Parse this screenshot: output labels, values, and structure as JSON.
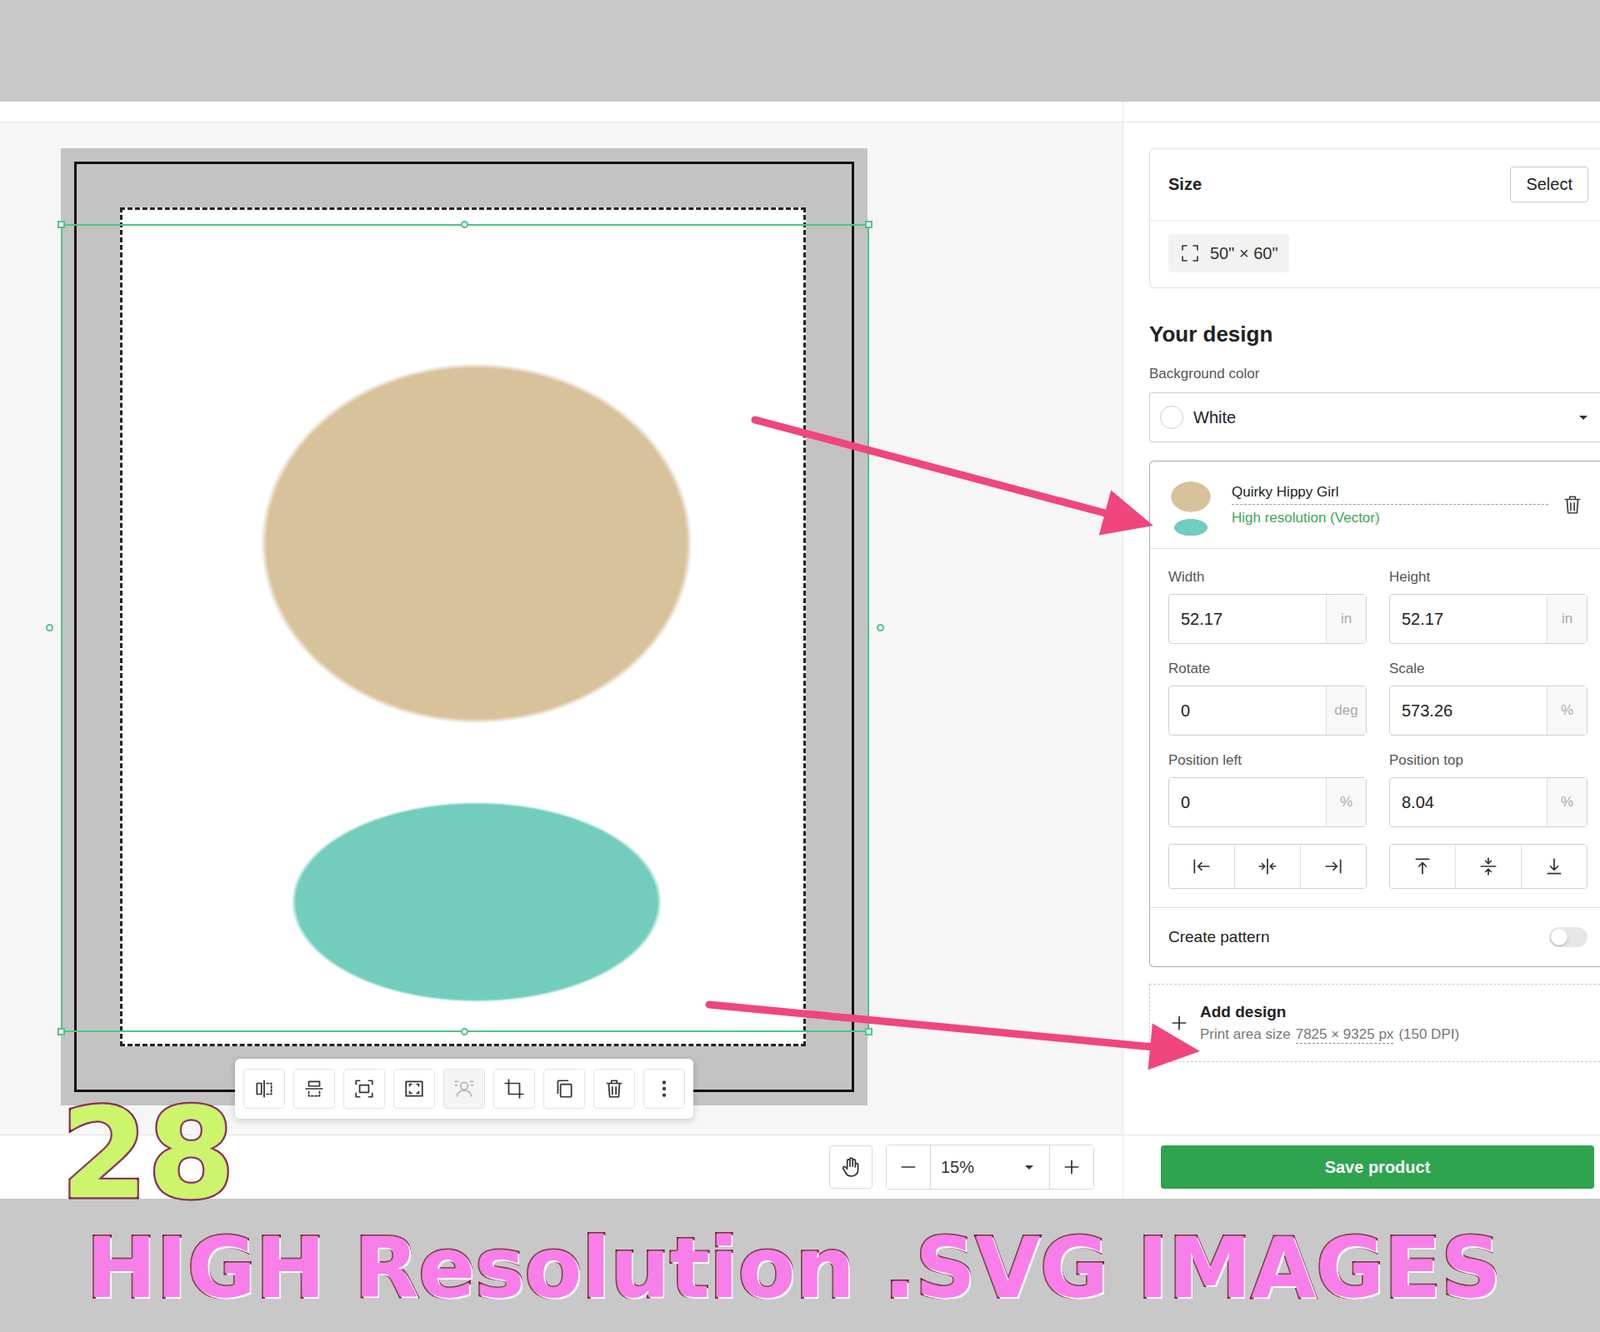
{
  "canvas": {
    "toolbar": [
      {
        "kind": "flip-h",
        "disabled": false
      },
      {
        "kind": "flip-v",
        "disabled": false
      },
      {
        "kind": "fit",
        "disabled": false
      },
      {
        "kind": "fill",
        "disabled": false
      },
      {
        "kind": "remove-bg",
        "disabled": true
      },
      {
        "kind": "crop",
        "disabled": false
      },
      {
        "kind": "copy",
        "disabled": false
      },
      {
        "kind": "trash",
        "disabled": false
      },
      {
        "kind": "more",
        "disabled": false
      }
    ]
  },
  "zoom": {
    "value": "15%"
  },
  "panel": {
    "size": {
      "label": "Size",
      "button": "Select",
      "value": "50\" × 60\""
    },
    "design_heading": "Your design",
    "background": {
      "label": "Background color",
      "value": "White"
    },
    "layer": {
      "name": "Quirky Hippy Girl",
      "quality": "High resolution (Vector)"
    },
    "fields": [
      {
        "label": "Width",
        "value": "52.17",
        "unit": "in"
      },
      {
        "label": "Height",
        "value": "52.17",
        "unit": "in"
      },
      {
        "label": "Rotate",
        "value": "0",
        "unit": "deg"
      },
      {
        "label": "Scale",
        "value": "573.26",
        "unit": "%"
      },
      {
        "label": "Position left",
        "value": "0",
        "unit": "%"
      },
      {
        "label": "Position top",
        "value": "8.04",
        "unit": "%"
      }
    ],
    "pattern": {
      "label": "Create pattern",
      "on": false
    },
    "add": {
      "label": "Add design",
      "prefix": "Print area size",
      "size": "7825 × 9325 px",
      "suffix": "(150 DPI)"
    },
    "save": "Save product"
  },
  "banner": {
    "count": "28",
    "text": "HIGH Resolution .SVG IMAGES"
  }
}
